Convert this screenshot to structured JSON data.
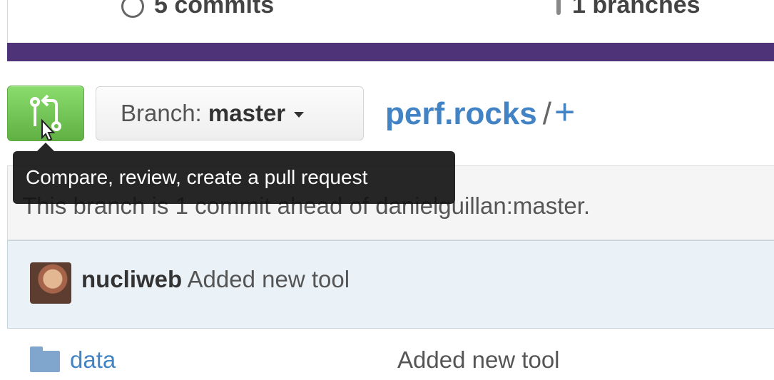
{
  "stats": {
    "commits_text": "5 commits",
    "branches_text": "1 branches",
    "commits_icon": "history-icon",
    "branches_icon": "branch-icon"
  },
  "toolbar": {
    "compare_icon": "compare-pull-request-icon",
    "branch_label": "Branch:",
    "branch_value": "master",
    "repo_name": "perf.rocks",
    "path_separator": "/",
    "add_file": "+"
  },
  "tooltip": {
    "text": "Compare, review, create a pull request"
  },
  "branch_status": {
    "text": "This branch is 1 commit ahead of danielguillan:master."
  },
  "latest_commit": {
    "author": "nucliweb",
    "message": "Added new tool"
  },
  "files": [
    {
      "icon": "folder-icon",
      "name": "data",
      "message": "Added new tool"
    }
  ],
  "colors": {
    "accent": "#4183c4",
    "compare_button": "#60b044",
    "language_bar": "#4e3378",
    "tooltip_bg": "#1a1a1a"
  }
}
